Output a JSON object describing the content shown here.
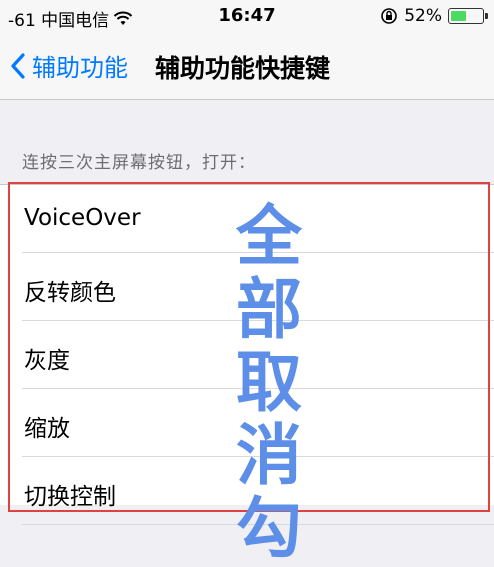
{
  "status_bar": {
    "carrier": "-61 中国电信",
    "time": "16:47",
    "battery_percent": "52%",
    "battery_level": 0.52,
    "icons": [
      "wifi-icon",
      "rotation-lock-icon",
      "battery-icon"
    ]
  },
  "nav": {
    "back_label": "辅助功能",
    "title": "辅助功能快捷键"
  },
  "section": {
    "header": "连按三次主屏幕按钮，打开："
  },
  "options": [
    {
      "label": "VoiceOver"
    },
    {
      "label": "反转颜色"
    },
    {
      "label": "灰度"
    },
    {
      "label": "缩放"
    },
    {
      "label": "切换控制"
    }
  ],
  "overlay_text": "全部取消勾",
  "colors": {
    "accent": "#007aff",
    "highlight_border": "#e0433f",
    "overlay_text": "#5d8ee8",
    "battery": "#4cd964"
  }
}
